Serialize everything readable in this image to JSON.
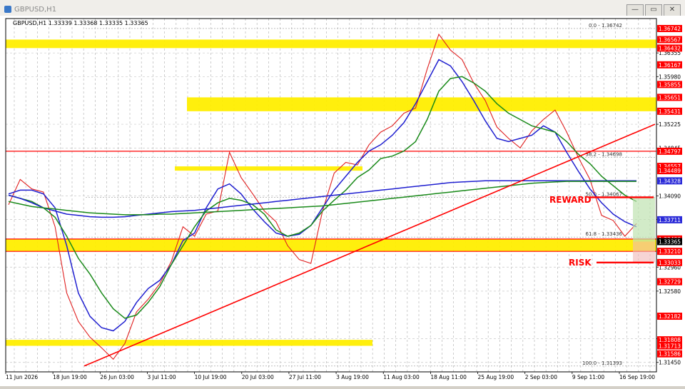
{
  "window": {
    "title": "GBPUSD,H1",
    "controls": {
      "minimize": "—",
      "restore": "▭",
      "close": "✕"
    }
  },
  "chart_header": "GBPUSD,H1  1.33339 1.33368 1.33335 1.33365",
  "chart_data": {
    "type": "line",
    "symbol": "GBPUSD",
    "timeframe": "H1",
    "ohlc": {
      "open": "1.33339",
      "high": "1.33368",
      "low": "1.33335",
      "close": "1.33365"
    },
    "ylim": [
      1.313,
      1.369
    ],
    "x_tick_labels": [
      "11 Jun 2026",
      "18 Jun 19:00",
      "26 Jun 03:00",
      "3 Jul 11:00",
      "10 Jul 19:00",
      "20 Jul 03:00",
      "27 Jul 11:00",
      "3 Aug 19:00",
      "11 Aug 03:00",
      "18 Aug 11:00",
      "25 Aug 19:00",
      "2 Sep 03:00",
      "9 Sep 11:00",
      "16 Sep 19:00"
    ],
    "price_axis_plain": [
      {
        "value": 1.36355,
        "label": "1.36355"
      },
      {
        "value": 1.3598,
        "label": "1.35980"
      },
      {
        "value": 1.35225,
        "label": "1.35225"
      },
      {
        "value": 1.34845,
        "label": "1.34845"
      },
      {
        "value": 1.3409,
        "label": "1.34090"
      },
      {
        "value": 1.33715,
        "label": "1.33715"
      },
      {
        "value": 1.3296,
        "label": "1.32960"
      },
      {
        "value": 1.3258,
        "label": "1.32580"
      },
      {
        "value": 1.31825,
        "label": "1.31825"
      },
      {
        "value": 1.3145,
        "label": "1.31450"
      }
    ],
    "price_axis_marked": [
      {
        "value": 1.36742,
        "label": "1.36742",
        "color": "#ff0000"
      },
      {
        "value": 1.36567,
        "label": "1.36567",
        "color": "#ff0000"
      },
      {
        "value": 1.36432,
        "label": "1.36432",
        "color": "#ff0000"
      },
      {
        "value": 1.36167,
        "label": "1.36167",
        "color": "#ff0000"
      },
      {
        "value": 1.35855,
        "label": "1.35855",
        "color": "#ff0000"
      },
      {
        "value": 1.35651,
        "label": "1.35651",
        "color": "#ff0000"
      },
      {
        "value": 1.35431,
        "label": "1.35431",
        "color": "#ff0000"
      },
      {
        "value": 1.34797,
        "label": "1.34797",
        "color": "#ff0000"
      },
      {
        "value": 1.34557,
        "label": "1.34557",
        "color": "#ff0000"
      },
      {
        "value": 1.34489,
        "label": "1.34489",
        "color": "#ff0000"
      },
      {
        "value": 1.34328,
        "label": "1.34328",
        "color": "#2b2bd8"
      },
      {
        "value": 1.33711,
        "label": "1.33711",
        "color": "#2b2bd8"
      },
      {
        "value": 1.33406,
        "label": "1.33406",
        "color": "#ff0000"
      },
      {
        "value": 1.33365,
        "label": "1.33365",
        "color": "#000000"
      },
      {
        "value": 1.3321,
        "label": "1.33210",
        "color": "#ff0000"
      },
      {
        "value": 1.33033,
        "label": "1.33033",
        "color": "#ff0000"
      },
      {
        "value": 1.32729,
        "label": "1.32729",
        "color": "#ff0000"
      },
      {
        "value": 1.32182,
        "label": "1.32182",
        "color": "#ff0000"
      },
      {
        "value": 1.31808,
        "label": "1.31808",
        "color": "#ff0000"
      },
      {
        "value": 1.31713,
        "label": "1.31713",
        "color": "#ff0000"
      },
      {
        "value": 1.31586,
        "label": "1.31586",
        "color": "#ff0000"
      }
    ],
    "fibonacci": [
      {
        "level": "0.0",
        "value": 1.36742,
        "label": "0.0 - 1.36742"
      },
      {
        "level": "38.2",
        "value": 1.34698,
        "label": "38.2 - 1.34698"
      },
      {
        "level": "50.0",
        "value": 1.34067,
        "label": "50.0 - 1.34067"
      },
      {
        "level": "61.8",
        "value": 1.33436,
        "label": "61.8 - 1.33436"
      },
      {
        "level": "100.0",
        "value": 1.31393,
        "label": "100.0 - 1.31393"
      }
    ],
    "horizontal_lines": [
      1.34797,
      1.33406,
      1.3321
    ],
    "zones": [
      {
        "from": 1.36432,
        "to": 1.36567
      },
      {
        "from": 1.35431,
        "to": 1.35651
      },
      {
        "from": 1.34489,
        "to": 1.34557
      },
      {
        "from": 1.3321,
        "to": 1.33406
      },
      {
        "from": 1.31713,
        "to": 1.31808
      }
    ],
    "trendline": {
      "from_price": 1.31393,
      "to_price": 1.35225
    },
    "reward_label": "REWARD",
    "risk_label": "RISK",
    "series": [
      {
        "color": "#e02020",
        "values": [
          1.3395,
          1.3435,
          1.342,
          1.3415,
          1.336,
          1.3255,
          1.321,
          1.3185,
          1.3168,
          1.315,
          1.3175,
          1.3225,
          1.3245,
          1.327,
          1.3305,
          1.336,
          1.3345,
          1.338,
          1.3385,
          1.3478,
          1.3438,
          1.3412,
          1.3385,
          1.3368,
          1.333,
          1.3308,
          1.3302,
          1.3385,
          1.3445,
          1.3462,
          1.3458,
          1.349,
          1.351,
          1.352,
          1.354,
          1.3548,
          1.361,
          1.3665,
          1.364,
          1.3625,
          1.3588,
          1.356,
          1.3518,
          1.35,
          1.3485,
          1.3512,
          1.353,
          1.3545,
          1.351,
          1.347,
          1.3435,
          1.3378,
          1.337,
          1.3345,
          1.3365
        ]
      },
      {
        "color": "#1f1fd0",
        "values": [
          1.3412,
          1.3418,
          1.3418,
          1.3412,
          1.339,
          1.333,
          1.3255,
          1.3218,
          1.32,
          1.3195,
          1.321,
          1.324,
          1.3262,
          1.3275,
          1.33,
          1.3338,
          1.335,
          1.339,
          1.342,
          1.3428,
          1.3412,
          1.3388,
          1.3368,
          1.335,
          1.3345,
          1.3348,
          1.3362,
          1.339,
          1.3418,
          1.344,
          1.3462,
          1.348,
          1.349,
          1.3505,
          1.3525,
          1.3555,
          1.359,
          1.3625,
          1.3615,
          1.359,
          1.356,
          1.3528,
          1.35,
          1.3495,
          1.35,
          1.3505,
          1.352,
          1.351,
          1.3478,
          1.3448,
          1.342,
          1.3398,
          1.338,
          1.3368,
          1.336
        ]
      },
      {
        "color": "#1a8a1a",
        "values": [
          1.341,
          1.3405,
          1.34,
          1.339,
          1.3375,
          1.3345,
          1.331,
          1.3285,
          1.3255,
          1.323,
          1.3215,
          1.322,
          1.324,
          1.3265,
          1.33,
          1.333,
          1.336,
          1.3385,
          1.3398,
          1.3405,
          1.3402,
          1.3395,
          1.338,
          1.3355,
          1.3345,
          1.335,
          1.3362,
          1.3385,
          1.3402,
          1.3418,
          1.3438,
          1.345,
          1.3468,
          1.3472,
          1.348,
          1.3495,
          1.353,
          1.3575,
          1.3595,
          1.3598,
          1.3588,
          1.3575,
          1.3555,
          1.354,
          1.353,
          1.352,
          1.3515,
          1.351,
          1.3495,
          1.3475,
          1.346,
          1.344,
          1.3425,
          1.341,
          1.34
        ]
      },
      {
        "color": "#1f1fd0",
        "values": [
          1.341,
          1.3405,
          1.3398,
          1.339,
          1.3385,
          1.338,
          1.3378,
          1.3376,
          1.3375,
          1.3375,
          1.3376,
          1.3378,
          1.338,
          1.3382,
          1.3384,
          1.3385,
          1.3386,
          1.3388,
          1.339,
          1.3392,
          1.3394,
          1.3396,
          1.3398,
          1.34,
          1.3402,
          1.3404,
          1.3406,
          1.3408,
          1.341,
          1.3412,
          1.3414,
          1.3416,
          1.3418,
          1.342,
          1.3422,
          1.3424,
          1.3426,
          1.3428,
          1.343,
          1.3431,
          1.3432,
          1.3433,
          1.3433,
          1.3433,
          1.3433,
          1.3433,
          1.3433,
          1.3433,
          1.3433,
          1.3433,
          1.3433,
          1.3433,
          1.3433,
          1.3433,
          1.3433
        ]
      },
      {
        "color": "#1a8a1a",
        "values": [
          1.34,
          1.3396,
          1.3392,
          1.339,
          1.3388,
          1.3386,
          1.3384,
          1.3382,
          1.3381,
          1.338,
          1.3379,
          1.3379,
          1.3379,
          1.338,
          1.338,
          1.3381,
          1.3382,
          1.3383,
          1.3384,
          1.3385,
          1.3386,
          1.3387,
          1.3388,
          1.3389,
          1.339,
          1.3391,
          1.3392,
          1.3393,
          1.3395,
          1.3397,
          1.3399,
          1.3401,
          1.3403,
          1.3405,
          1.3407,
          1.3409,
          1.3411,
          1.3413,
          1.3415,
          1.3417,
          1.3419,
          1.3421,
          1.3423,
          1.3425,
          1.3427,
          1.3429,
          1.343,
          1.3431,
          1.3432,
          1.3432,
          1.3432,
          1.3432,
          1.3432,
          1.3432,
          1.3432
        ]
      }
    ]
  }
}
